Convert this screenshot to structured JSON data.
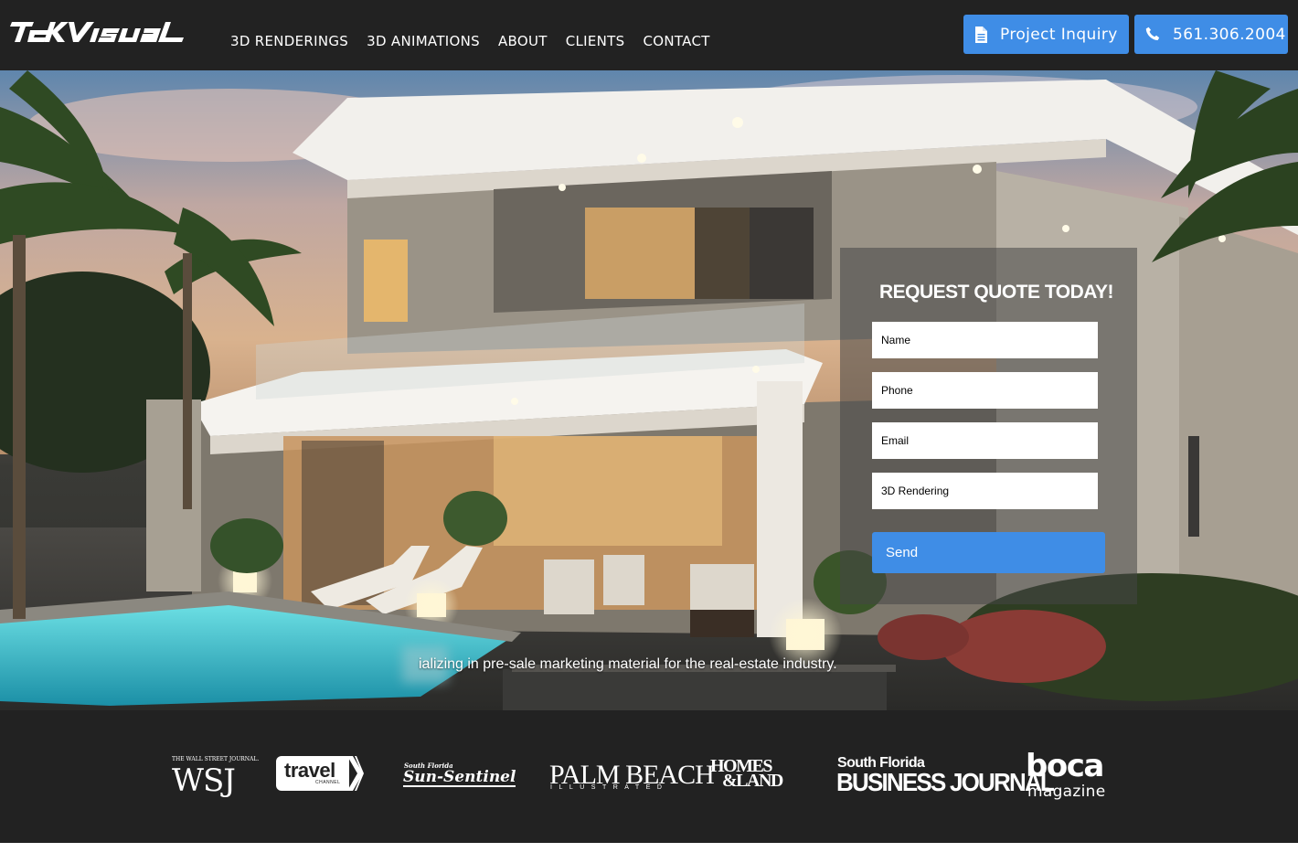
{
  "header": {
    "logo_text": "TekVisual",
    "nav": [
      "3D RENDERINGS",
      "3D ANIMATIONS",
      "ABOUT",
      "CLIENTS",
      "CONTACT"
    ],
    "inquiry_button": {
      "label": "Project Inquiry",
      "icon": "document-icon"
    },
    "phone_button": {
      "label": "561.306.2004",
      "icon": "phone-icon"
    }
  },
  "hero": {
    "tagline": "Specializing in pre-sale marketing material for the real-estate industry.",
    "tagline_visible": "ializing in pre-sale marketing material for the real-estate industry."
  },
  "quote_form": {
    "title": "REQUEST QUOTE TODAY!",
    "fields": [
      {
        "name": "name",
        "value": "Name"
      },
      {
        "name": "phone",
        "value": "Phone"
      },
      {
        "name": "email",
        "value": "Email"
      },
      {
        "name": "service",
        "value": "3D Rendering"
      }
    ],
    "submit_label": "Send"
  },
  "press": {
    "wsj_small": "THE WALL STREET JOURNAL.",
    "wsj": "WSJ",
    "travel": "travel",
    "travel_channel": "CHANNEL",
    "sun_sentinel_small": "South Florida",
    "sun_sentinel": "Sun-Sentinel",
    "palm_beach": "PALM BEACH",
    "palm_beach_small": "ILLUSTRATED",
    "homes_land_1": "HOMES",
    "homes_land_2": "&LAND",
    "sfbj_1": "South Florida",
    "sfbj_2": "BUSINESS JOURNAL",
    "boca_1": "boca",
    "boca_2": "magazine"
  },
  "colors": {
    "header_bg": "#222222",
    "accent": "#3f8de6",
    "panel": "rgba(70,70,70,0.55)"
  }
}
